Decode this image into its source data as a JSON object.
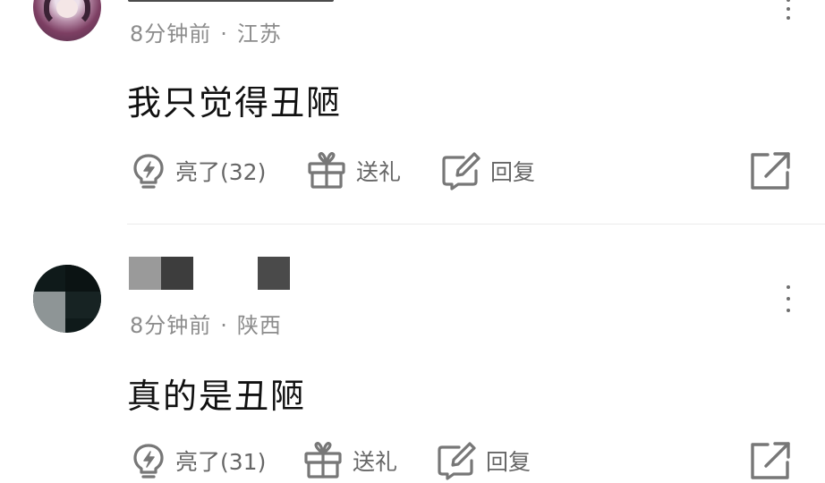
{
  "comments": [
    {
      "time": "8分钟前",
      "separator": "·",
      "location": "江苏",
      "text": "我只觉得丑陋",
      "like_label": "亮了(32)",
      "gift_label": "送礼",
      "reply_label": "回复"
    },
    {
      "time": "8分钟前",
      "separator": "·",
      "location": "陕西",
      "text": "真的是丑陋",
      "like_label": "亮了(31)",
      "gift_label": "送礼",
      "reply_label": "回复"
    }
  ],
  "colors": {
    "meta": "#8c8c8c",
    "action": "#666666",
    "divider": "#ececec"
  },
  "icons": [
    "lightbulb-icon",
    "gift-icon",
    "reply-edit-icon",
    "share-icon",
    "more-icon"
  ]
}
